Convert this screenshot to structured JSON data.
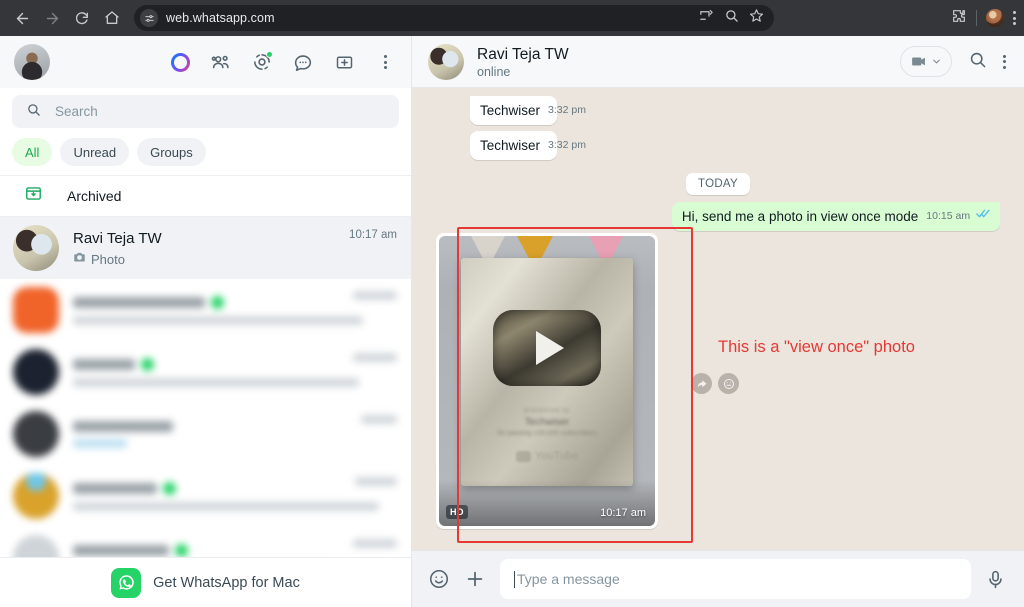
{
  "browser": {
    "url": "web.whatsapp.com",
    "back_label": "Back",
    "forward_label": "Forward",
    "reload_label": "Reload",
    "home_label": "Home",
    "site_settings_icon": "tune-icon",
    "cast_icon": "cast-icon",
    "zoom_icon": "zoom-search-icon",
    "bookmark_icon": "star-icon",
    "extensions_icon": "puzzle-icon",
    "profile_icon": "profile-avatar",
    "menu_icon": "kebab-menu-icon"
  },
  "sidebar": {
    "profile_avatar": "user-avatar",
    "nav": [
      {
        "name": "meta-ai",
        "label": "Meta AI"
      },
      {
        "name": "communities",
        "label": "Communities"
      },
      {
        "name": "status",
        "label": "Status",
        "badge": true
      },
      {
        "name": "channels",
        "label": "Channels"
      },
      {
        "name": "new-chat",
        "label": "New chat"
      },
      {
        "name": "menu",
        "label": "Menu"
      }
    ],
    "search": {
      "placeholder": "Search",
      "icon": "search-icon"
    },
    "filters": [
      {
        "label": "All",
        "active": true
      },
      {
        "label": "Unread",
        "active": false
      },
      {
        "label": "Groups",
        "active": false
      }
    ],
    "archived": {
      "label": "Archived",
      "icon": "archive-icon"
    },
    "chats": [
      {
        "name": "Ravi Teja TW",
        "preview": "Photo",
        "preview_icon": "camera-icon",
        "time": "10:17 am",
        "selected": true,
        "redacted": false
      },
      {
        "name": "",
        "preview": "",
        "time": "",
        "selected": false,
        "redacted": true,
        "avatar_color": "#f0642a"
      },
      {
        "name": "",
        "preview": "",
        "time": "",
        "selected": false,
        "redacted": true,
        "avatar_color": "#1c2230"
      },
      {
        "name": "",
        "preview": "",
        "time": "",
        "selected": false,
        "redacted": true,
        "avatar_color": "#3a3d42"
      },
      {
        "name": "",
        "preview": "",
        "time": "",
        "selected": false,
        "redacted": true,
        "avatar_color": "#d9a22b"
      },
      {
        "name": "",
        "preview": "",
        "time": "",
        "selected": false,
        "redacted": true,
        "avatar_color": "#cfd4d8"
      }
    ],
    "get_app": {
      "label": "Get WhatsApp for Mac",
      "icon": "whatsapp-logo"
    }
  },
  "chat": {
    "contact_name": "Ravi Teja TW",
    "status": "online",
    "video_call_label": "Video call",
    "search_icon": "search-icon",
    "menu_icon": "kebab-menu-icon",
    "messages": [
      {
        "type": "in",
        "text": "Techwiser",
        "time": "3:32 pm"
      },
      {
        "type": "in",
        "text": "Techwiser",
        "time": "3:32 pm"
      },
      {
        "type": "divider",
        "text": "TODAY"
      },
      {
        "type": "out",
        "text": "Hi, send me a photo in view once mode",
        "time": "10:15 am",
        "status": "read"
      },
      {
        "type": "photo",
        "time": "10:17 am",
        "quality_badge": "HD"
      }
    ],
    "photo_caption_lines": {
      "l1": "presented to",
      "l2": "Techwiser",
      "l3": "for passing 100,000 subscribers",
      "brand": "YouTube"
    },
    "hover_actions": [
      {
        "name": "forward-message-button",
        "icon": "forward-arrow-icon"
      },
      {
        "name": "react-message-button",
        "icon": "emoji-icon"
      }
    ]
  },
  "annotation": {
    "text": "This is a \"view once\" photo",
    "color": "#e53935"
  },
  "composer": {
    "emoji_icon": "emoji-icon",
    "attach_icon": "plus-icon",
    "placeholder": "Type a message",
    "value": "",
    "mic_icon": "microphone-icon"
  }
}
